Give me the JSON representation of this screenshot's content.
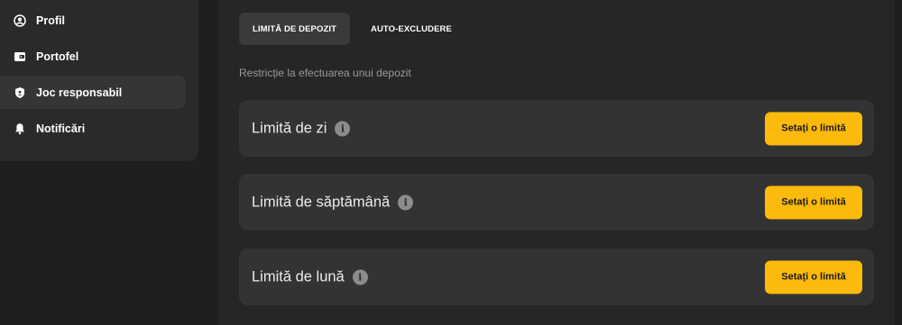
{
  "sidebar": {
    "items": [
      {
        "label": "Profil",
        "icon": "user-circle-icon"
      },
      {
        "label": "Portofel",
        "icon": "wallet-icon"
      },
      {
        "label": "Joc responsabil",
        "icon": "shield-icon",
        "active": true
      },
      {
        "label": "Notificări",
        "icon": "bell-icon"
      }
    ]
  },
  "tabs": [
    {
      "label": "LIMITĂ DE DEPOZIT",
      "active": true
    },
    {
      "label": "AUTO-EXCLUDERE",
      "active": false
    }
  ],
  "subtitle": "Restricție la efectuarea unui depozit",
  "limits": [
    {
      "title": "Limită de zi",
      "button": "Setați o limită"
    },
    {
      "title": "Limită de săptămână",
      "button": "Setați o limită"
    },
    {
      "title": "Limită de lună",
      "button": "Setați o limită"
    }
  ],
  "colors": {
    "accent": "#fbba0c",
    "background": "#1f1f1f",
    "panel": "#262626",
    "card": "#333333"
  }
}
